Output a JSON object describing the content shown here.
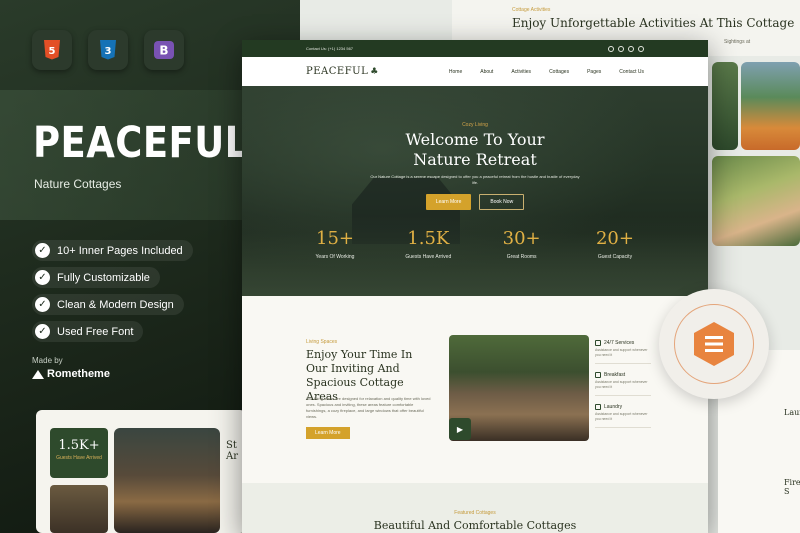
{
  "badges": [
    {
      "name": "html5",
      "glyph": "5",
      "color": "#e34f26"
    },
    {
      "name": "css3",
      "glyph": "3",
      "color": "#1572b6"
    },
    {
      "name": "bootstrap",
      "glyph": "B",
      "color": "#7952b3"
    }
  ],
  "brand": {
    "title": "PEACEFULL",
    "subtitle": "Nature Cottages"
  },
  "features": [
    "10+ Inner Pages Included",
    "Fully Customizable",
    "Clean & Modern Design",
    "Used Free Font"
  ],
  "made_by": {
    "label": "Made by",
    "author": "Rometheme"
  },
  "activities": {
    "kicker": "Cottage Activities",
    "title": "Enjoy Unforgettable Activities At This Cottage",
    "sub": "Sightings at"
  },
  "site": {
    "topbar": {
      "contact": "Contact Us: (+1) 1234 567"
    },
    "logo": "PEACEFUL",
    "nav": [
      "Home",
      "About",
      "Activities",
      "Cottages",
      "Pages",
      "Contact Us"
    ],
    "hero": {
      "kicker": "Cozy Living",
      "title_line1": "Welcome To Your",
      "title_line2": "Nature Retreat",
      "desc": "Our Nature Cottage is a serene escape designed to offer you a peaceful retreat from the hustle and bustle of everyday life.",
      "btn_primary": "Learn More",
      "btn_secondary": "Book Now",
      "stats": [
        {
          "num": "15+",
          "label": "Years Of Working"
        },
        {
          "num": "1.5K",
          "label": "Guests Have Arrived"
        },
        {
          "num": "30+",
          "label": "Great Rooms"
        },
        {
          "num": "20+",
          "label": "Guest Capacity"
        }
      ]
    },
    "living": {
      "kicker": "Living Spaces",
      "title": "Enjoy Your Time In Our Inviting And Spacious Cottage Areas",
      "desc": "Our living areas are designed for relaxation and quality time with loved ones. Spacious and inviting, these areas feature comfortable furnishings, a cozy fireplace, and large windows that offer beautiful views.",
      "button": "Learn More",
      "amenities": [
        {
          "name": "24/7 Services",
          "text": "Assistance and support whenever you need it"
        },
        {
          "name": "Breakfast",
          "text": "Assistance and support whenever you need it"
        },
        {
          "name": "Laundry",
          "text": "Assistance and support whenever you need it"
        }
      ]
    },
    "featured": {
      "kicker": "Featured Cottages",
      "title": "Beautiful And Comfortable Cottages"
    }
  },
  "stat_card": {
    "num": "1.5K+",
    "label": "Guests Have Arrived",
    "side": "St Ar"
  },
  "right_card": {
    "items": [
      "Laun",
      "Fire S"
    ]
  },
  "colors": {
    "dark_green": "#233a22",
    "gold": "#d4a22b",
    "seal_orange": "#e8843f"
  }
}
